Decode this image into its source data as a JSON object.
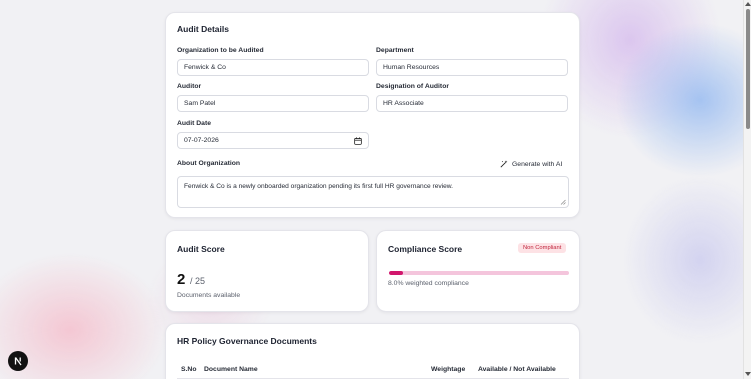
{
  "audit_details": {
    "title": "Audit Details",
    "org_label": "Organization to be Audited",
    "org_value": "Fenwick & Co",
    "dept_label": "Department",
    "dept_value": "Human Resources",
    "auditor_label": "Auditor",
    "auditor_value": "Sam Patel",
    "designation_label": "Designation of Auditor",
    "designation_value": "HR Associate",
    "date_label": "Audit Date",
    "date_value": "07-07-2026",
    "about_label": "About Organization",
    "ai_button_label": "Generate with AI",
    "about_value": "Fenwick & Co is a newly onboarded organization pending its first full HR governance review."
  },
  "audit_score": {
    "title": "Audit Score",
    "score": "2",
    "total": "/ 25",
    "caption": "Documents available"
  },
  "compliance_score": {
    "title": "Compliance Score",
    "status_badge": "Non Compliant",
    "progress_fraction": 0.08,
    "caption": "8.0% weighted compliance"
  },
  "documents": {
    "title": "HR Policy Governance Documents",
    "columns": [
      "S.No",
      "Document Name",
      "Weightage",
      "Available / Not Available"
    ]
  },
  "colors": {
    "accent": "#d1176d",
    "badge_bg": "#fde2e5",
    "badge_text": "#c0263d"
  },
  "icons": {
    "calendar": "calendar-icon",
    "ai": "magic-wand-icon",
    "framework_badge": "next-logo-icon"
  }
}
